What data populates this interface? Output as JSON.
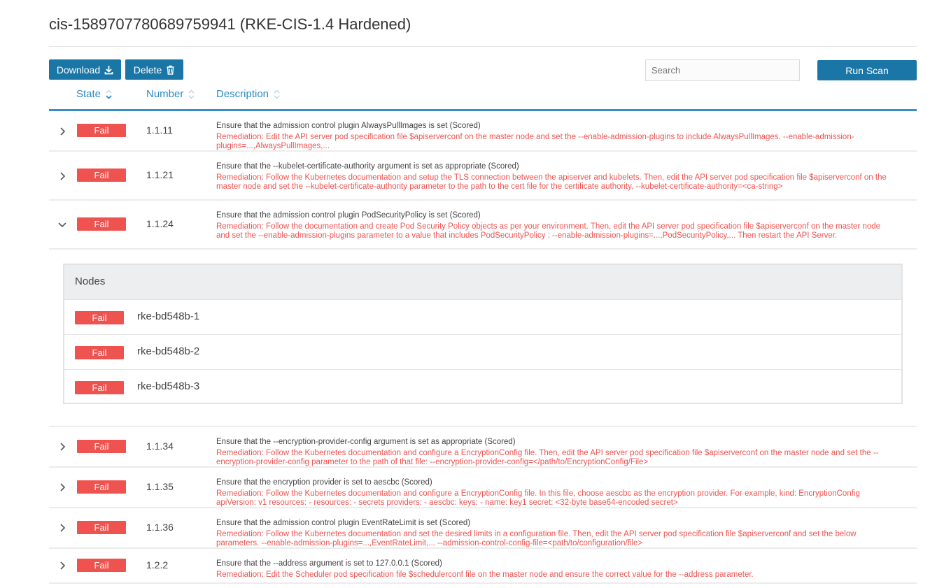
{
  "page": {
    "title": "cis-1589707780689759941 (RKE-CIS-1.4 Hardened)"
  },
  "toolbar": {
    "download_label": "Download",
    "delete_label": "Delete",
    "search_placeholder": "Search",
    "run_scan_label": "Run Scan"
  },
  "table": {
    "headers": {
      "state": "State",
      "number": "Number",
      "description": "Description"
    },
    "rows": [
      {
        "state": "Fail",
        "number": "1.1.11",
        "expanded": false,
        "title": "Ensure that the admission control plugin AlwaysPullImages is set (Scored)",
        "remediation": "Remediation: Edit the API server pod specification file $apiserverconf on the master node and set the --enable-admission-plugins to include AlwaysPullImages. --enable-admission-plugins=...,AlwaysPullImages,..."
      },
      {
        "state": "Fail",
        "number": "1.1.21",
        "expanded": false,
        "title": "Ensure that the --kubelet-certificate-authority argument is set as appropriate (Scored)",
        "remediation": "Remediation: Follow the Kubernetes documentation and setup the TLS connection between the apiserver and kubelets. Then, edit the API server pod specification file $apiserverconf on the master node and set the --kubelet-certificate-authority parameter to the path to the cert file for the certificate authority. --kubelet-certificate-authority=<ca-string>"
      },
      {
        "state": "Fail",
        "number": "1.1.24",
        "expanded": true,
        "title": "Ensure that the admission control plugin PodSecurityPolicy is set (Scored)",
        "remediation": "Remediation: Follow the documentation and create Pod Security Policy objects as per your environment. Then, edit the API server pod specification file $apiserverconf on the master node and set the --enable-admission-plugins parameter to a value that includes PodSecurityPolicy : --enable-admission-plugins=...,PodSecurityPolicy,... Then restart the API Server."
      },
      {
        "state": "Fail",
        "number": "1.1.34",
        "expanded": false,
        "title": "Ensure that the --encryption-provider-config argument is set as appropriate (Scored)",
        "remediation": "Remediation: Follow the Kubernetes documentation and configure a EncryptionConfig file. Then, edit the API server pod specification file $apiserverconf on the master node and set the --encryption-provider-config parameter to the path of that file: --encryption-provider-config=</path/to/EncryptionConfig/File>"
      },
      {
        "state": "Fail",
        "number": "1.1.35",
        "expanded": false,
        "title": "Ensure that the encryption provider is set to aescbc (Scored)",
        "remediation": "Remediation: Follow the Kubernetes documentation and configure a EncryptionConfig file. In this file, choose aescbc as the encryption provider. For example, kind: EncryptionConfig apiVersion: v1 resources: - resources: - secrets providers: - aescbc: keys: - name: key1 secret: <32-byte base64-encoded secret>"
      },
      {
        "state": "Fail",
        "number": "1.1.36",
        "expanded": false,
        "title": "Ensure that the admission control plugin EventRateLimit is set (Scored)",
        "remediation": "Remediation: Follow the Kubernetes documentation and set the desired limits in a configuration file. Then, edit the API server pod specification file $apiserverconf and set the below parameters. --enable-admission-plugins=...,EventRateLimit,... --admission-control-config-file=<path/to/configuration/file>"
      },
      {
        "state": "Fail",
        "number": "1.2.2",
        "expanded": false,
        "title": "Ensure that the --address argument is set to 127.0.0.1 (Scored)",
        "remediation": "Remediation: Edit the Scheduler pod specification file $schedulerconf file on the master node and ensure the correct value for the --address parameter."
      }
    ]
  },
  "nodes": {
    "heading": "Nodes",
    "items": [
      {
        "state": "Fail",
        "name": "rke-bd548b-1"
      },
      {
        "state": "Fail",
        "name": "rke-bd548b-2"
      },
      {
        "state": "Fail",
        "name": "rke-bd548b-3"
      }
    ]
  },
  "colors": {
    "primary": "#1a76a6",
    "accent_blue": "#2d8ac1",
    "fail": "#ef5350"
  }
}
